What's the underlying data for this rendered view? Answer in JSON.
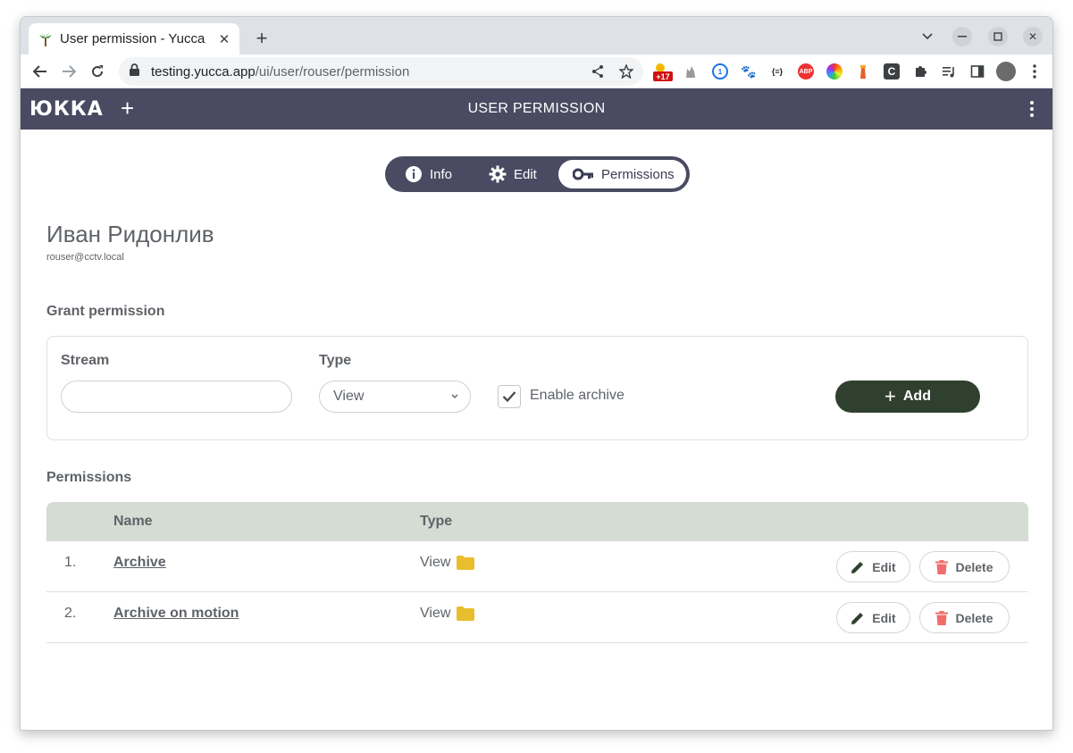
{
  "browser": {
    "tab_title": "User permission - Yucca",
    "url_host": "testing.yucca.app",
    "url_path": "/ui/user/rouser/permission",
    "extension_badge": "+17"
  },
  "app": {
    "logo": "ЮККА",
    "header_title": "USER PERMISSION"
  },
  "tabs": [
    {
      "label": "Info",
      "icon": "info-icon"
    },
    {
      "label": "Edit",
      "icon": "gear-icon"
    },
    {
      "label": "Permissions",
      "icon": "key-icon",
      "active": true
    }
  ],
  "user": {
    "name": "Иван Ридонлив",
    "email": "rouser@cctv.local"
  },
  "grant": {
    "section_title": "Grant permission",
    "stream_label": "Stream",
    "stream_value": "",
    "type_label": "Type",
    "type_value": "View",
    "enable_archive_label": "Enable archive",
    "enable_archive_checked": true,
    "add_label": "Add"
  },
  "permissions": {
    "section_title": "Permissions",
    "columns": {
      "name": "Name",
      "type": "Type"
    },
    "rows": [
      {
        "num": "1.",
        "name": "Archive",
        "type": "View",
        "edit": "Edit",
        "delete": "Delete"
      },
      {
        "num": "2.",
        "name": "Archive on motion",
        "type": "View",
        "edit": "Edit",
        "delete": "Delete"
      }
    ]
  },
  "colors": {
    "header_bg": "#4a4a62",
    "add_button": "#30402e",
    "table_header": "#d4dcd3",
    "folder": "#e8bd2e",
    "delete_icon": "#f26b6b"
  }
}
